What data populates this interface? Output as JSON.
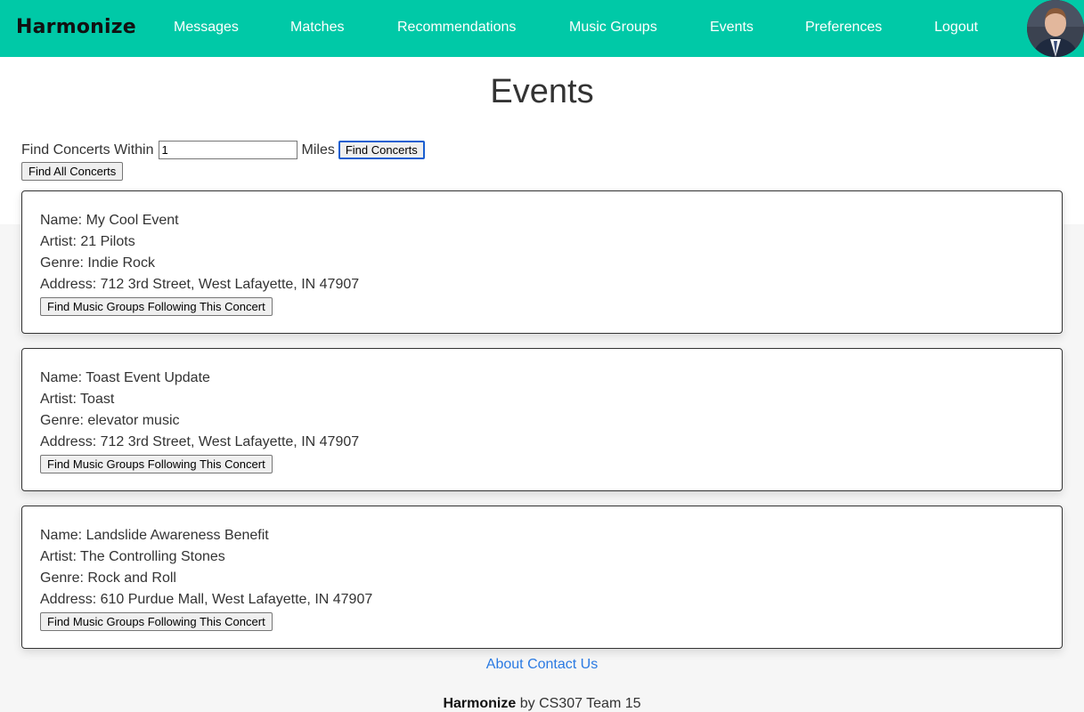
{
  "brand": {
    "name": "Harmonize"
  },
  "nav": {
    "items": [
      "Messages",
      "Matches",
      "Recommendations",
      "Music Groups",
      "Events",
      "Preferences",
      "Logout"
    ]
  },
  "page": {
    "title": "Events"
  },
  "search": {
    "prefix": "Find Concerts Within",
    "value": "1",
    "suffix": "Miles",
    "find_button": "Find Concerts",
    "find_all_button": "Find All Concerts"
  },
  "events": [
    {
      "name": "Name: My Cool Event",
      "artist": "Artist: 21 Pilots",
      "genre": "Genre: Indie Rock",
      "address": "Address: 712 3rd Street, West Lafayette, IN 47907",
      "button": "Find Music Groups Following This Concert"
    },
    {
      "name": "Name: Toast Event Update",
      "artist": "Artist: Toast",
      "genre": "Genre: elevator music",
      "address": "Address: 712 3rd Street, West Lafayette, IN 47907",
      "button": "Find Music Groups Following This Concert"
    },
    {
      "name": "Name: Landslide Awareness Benefit",
      "artist": "Artist: The Controlling Stones",
      "genre": "Genre: Rock and Roll",
      "address": "Address: 610 Purdue Mall, West Lafayette, IN 47907",
      "button": "Find Music Groups Following This Concert"
    }
  ],
  "footer": {
    "about": "About",
    "contact": "Contact Us",
    "brand": "Harmonize",
    "credit": "by CS307 Team 15"
  },
  "colors": {
    "navbar": "#00c9a7",
    "link": "#2a7ae2"
  }
}
